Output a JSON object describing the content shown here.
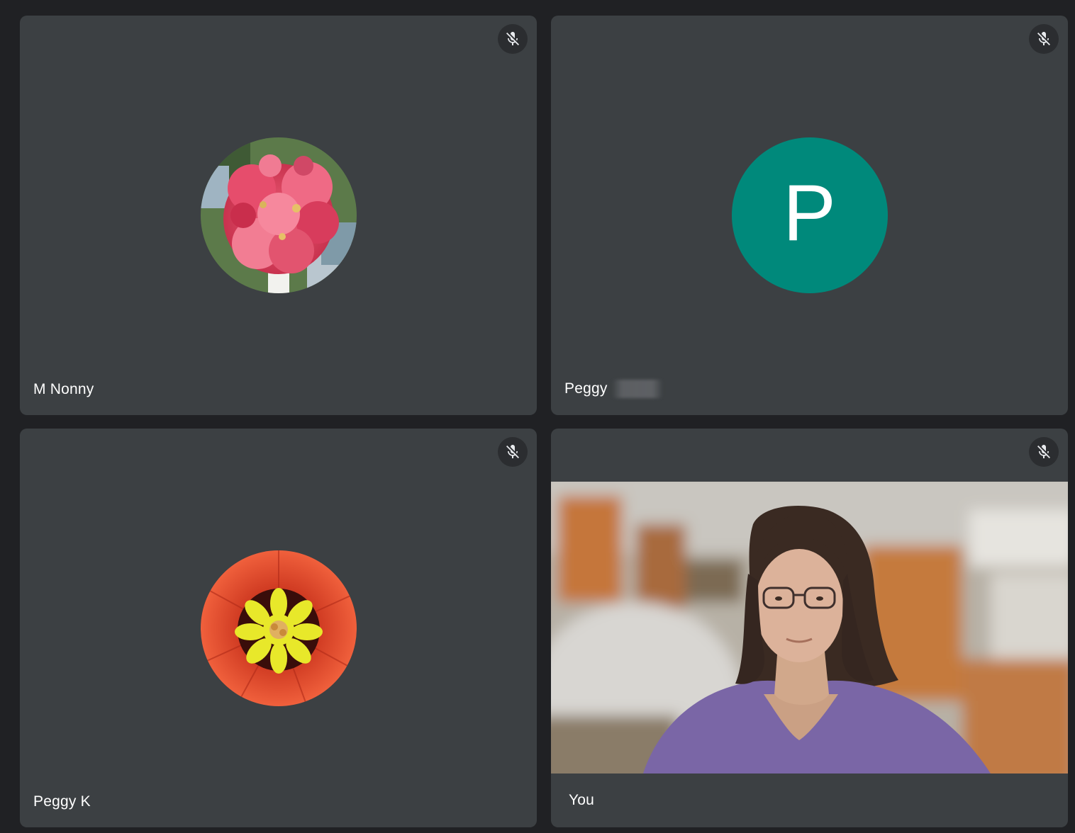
{
  "participants": [
    {
      "name": "M Nonny",
      "avatar": "pink-flower-photo",
      "muted": true
    },
    {
      "name": "Peggy",
      "name_suffix_redacted": true,
      "avatar_letter": "P",
      "avatar_color": "#00897b",
      "muted": true
    },
    {
      "name": "Peggy K",
      "avatar": "red-yellow-flower-photo",
      "muted": true
    },
    {
      "name": "You",
      "video": "self-camera-feed",
      "muted": true
    }
  ],
  "icons": {
    "mute": "mic-off-icon"
  },
  "colors": {
    "background": "#202124",
    "tile": "#3c4043",
    "avatar_teal": "#00897b"
  }
}
